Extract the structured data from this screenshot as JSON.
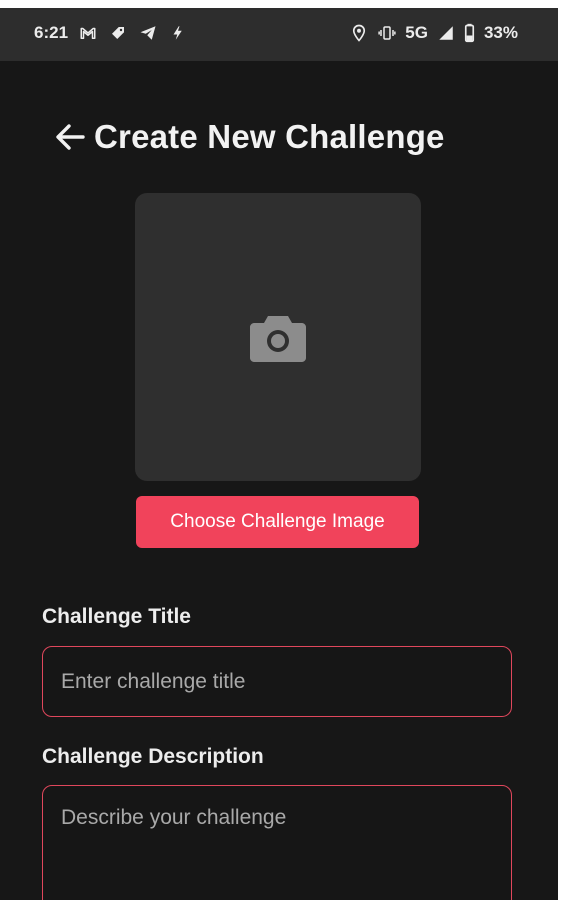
{
  "status_bar": {
    "time": "6:21",
    "left_icons": [
      "gmail-icon",
      "tag-icon",
      "telegram-icon",
      "bolt-icon"
    ],
    "right_icons": [
      "location-icon",
      "vibrate-icon"
    ],
    "network": "5G",
    "signal_icon": "signal-icon",
    "battery_icon": "battery-icon",
    "battery": "33%"
  },
  "header": {
    "back_icon": "arrow-left-icon",
    "title": "Create New Challenge"
  },
  "image_picker": {
    "icon": "camera-icon",
    "button_label": "Choose Challenge Image"
  },
  "form": {
    "title_label": "Challenge Title",
    "title_value": "",
    "title_placeholder": "Enter challenge title",
    "description_label": "Challenge Description",
    "description_value": "",
    "description_placeholder": "Describe your challenge"
  },
  "colors": {
    "background": "#171717",
    "status_bar": "#2d2d2d",
    "accent": "#f1435b",
    "input_border": "#e0475c",
    "image_box": "#2f2f2f"
  }
}
